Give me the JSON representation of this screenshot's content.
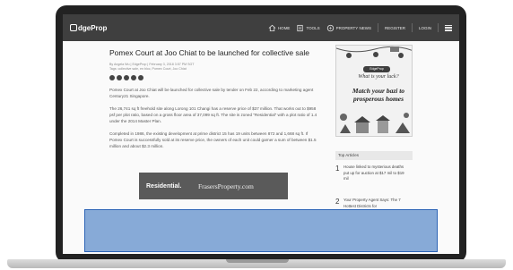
{
  "navbar": {
    "brand": "dgeProp",
    "items": [
      {
        "label": "HOME",
        "icon": "home-icon"
      },
      {
        "label": "TOOLS",
        "icon": "tools-icon"
      },
      {
        "label": "PROPERTY NEWS",
        "icon": "news-icon"
      }
    ],
    "register": "REGISTER",
    "login": "LOGIN"
  },
  "article": {
    "headline": "Pomex Court at Joo Chiat to be launched for collective sale",
    "byline": "By Angela Wu | EdgeProp | February 3, 2018 3:57 PM SGT",
    "tags": "Tags: collective sale, en bloc, Pomex Court, Joo Chiat",
    "paragraphs": [
      "Pomex Court at Joo Chiat will be launched for collective sale by tender on Feb 22, according to marketing agent Century21 Singapore.",
      "The 26,741 sq ft freehold site along Lorong 101 Changi has a reserve price of $37 million. That works out to $958 psf per plot ratio, based on a gross floor area of 37,099 sq ft. The site is zoned \"Residential\" with a plot ratio of 1.4 under the 2014 Master Plan.",
      "Completed in 1986, the existing development at prime district 15 has 19 units between 872 and 1,668 sq ft. If Pomex Court is successfully sold at its reserve price, the owners of each unit could garner a sum of between $1.5 million and about $2.3 million."
    ],
    "banner": {
      "left": "Residential.",
      "right": "FrasersProperty.com"
    }
  },
  "sidebar": {
    "ad": {
      "pill": "EdgeProp",
      "question": "What is your luck?",
      "headline": "Match your bazi to prosperous homes"
    },
    "top_articles_title": "Top Articles",
    "top_articles": [
      {
        "num": "1",
        "text": "House linked to mysterious deaths put up for auction at $17 mil to $19 mil"
      },
      {
        "num": "2",
        "text": "Your Property Agent Says: The 7 Hottest Districts for"
      }
    ]
  },
  "colors": {
    "navbar": "#3f3f3f",
    "bezel": "#222222",
    "selection_fill": "#6e98cf",
    "selection_border": "#2c63b5"
  }
}
